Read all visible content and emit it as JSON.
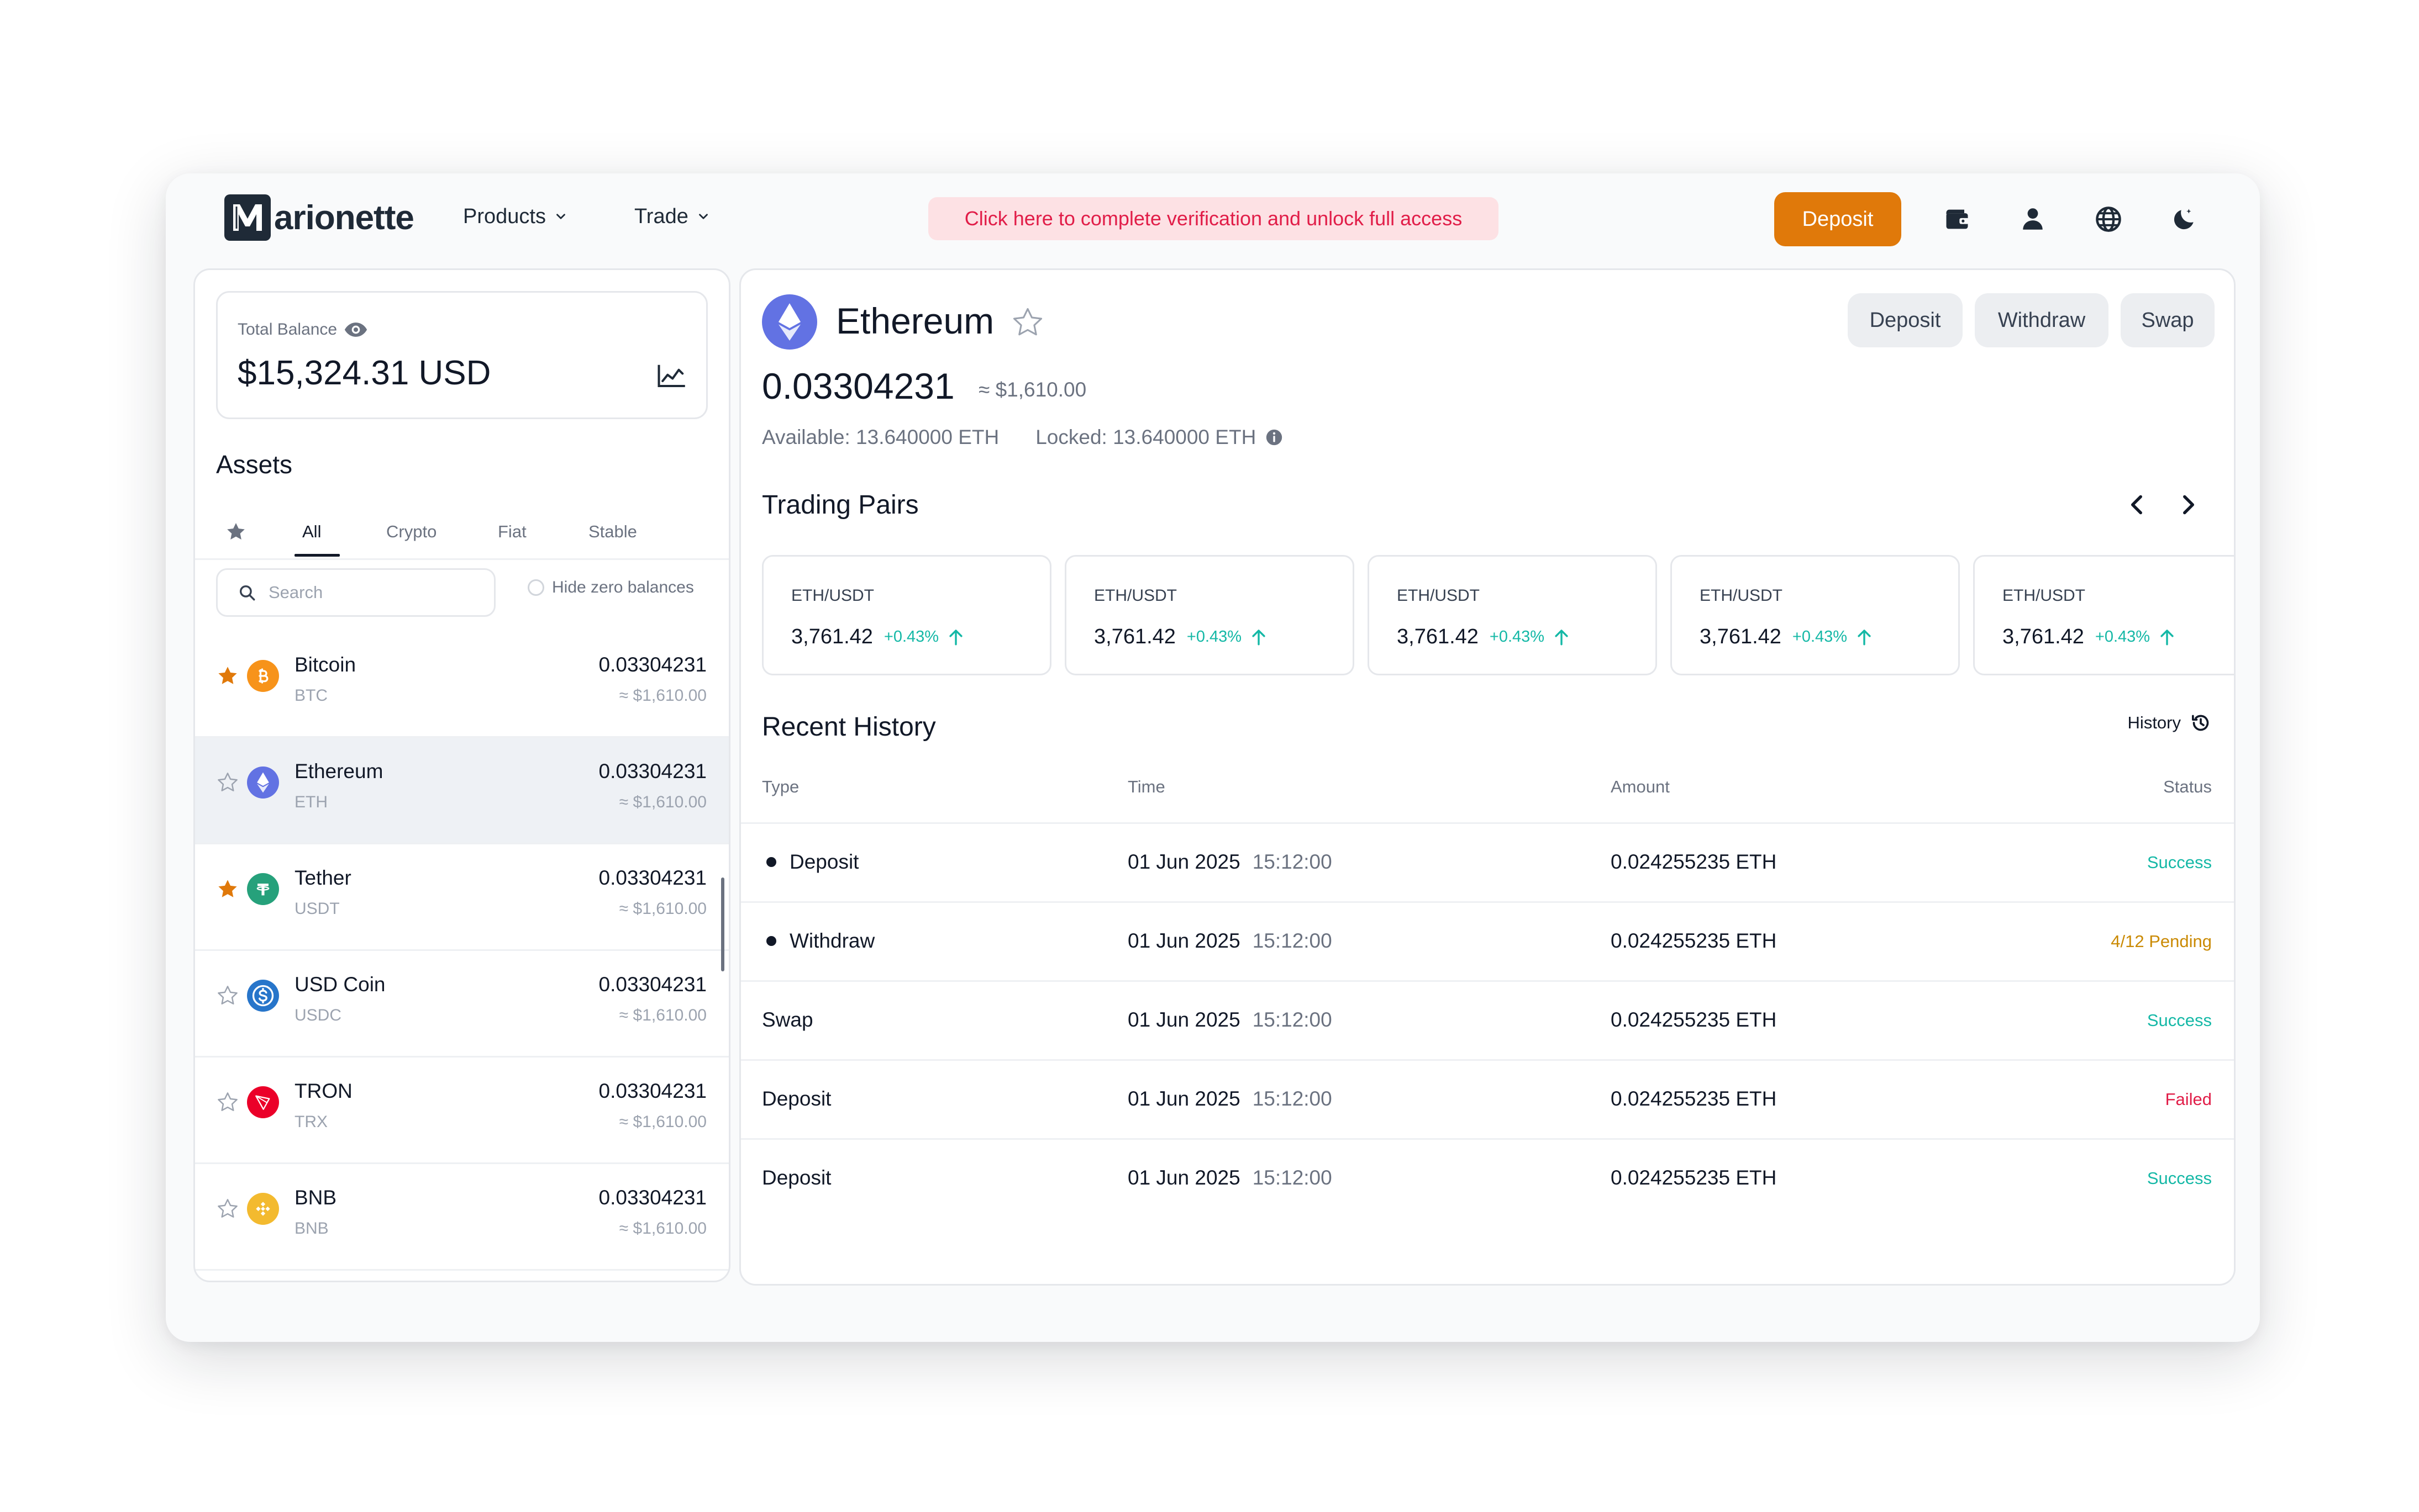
{
  "header": {
    "logo_text": "arionette",
    "nav": [
      {
        "label": "Products"
      },
      {
        "label": "Trade"
      }
    ],
    "banner": "Click here to complete verification and unlock full access",
    "deposit_label": "Deposit"
  },
  "balance": {
    "label": "Total Balance",
    "value": "$15,324.31 USD"
  },
  "assets": {
    "title": "Assets",
    "tabs": [
      "All",
      "Crypto",
      "Fiat",
      "Stable"
    ],
    "search_placeholder": "Search",
    "hide_zero_label": "Hide zero balances",
    "items": [
      {
        "name": "Bitcoin",
        "symbol": "BTC",
        "amount": "0.03304231",
        "usd": "≈ $1,610.00",
        "favorite": true,
        "color": "#f7931a"
      },
      {
        "name": "Ethereum",
        "symbol": "ETH",
        "amount": "0.03304231",
        "usd": "≈ $1,610.00",
        "favorite": false,
        "color": "#6272e3"
      },
      {
        "name": "Tether",
        "symbol": "USDT",
        "amount": "0.03304231",
        "usd": "≈ $1,610.00",
        "favorite": true,
        "color": "#26a17b"
      },
      {
        "name": "USD Coin",
        "symbol": "USDC",
        "amount": "0.03304231",
        "usd": "≈ $1,610.00",
        "favorite": false,
        "color": "#2775ca"
      },
      {
        "name": "TRON",
        "symbol": "TRX",
        "amount": "0.03304231",
        "usd": "≈ $1,610.00",
        "favorite": false,
        "color": "#eb0029"
      },
      {
        "name": "BNB",
        "symbol": "BNB",
        "amount": "0.03304231",
        "usd": "≈ $1,610.00",
        "favorite": false,
        "color": "#f3ba2f"
      }
    ]
  },
  "coin": {
    "name": "Ethereum",
    "amount": "0.03304231",
    "usd": "≈ $1,610.00",
    "available": "Available: 13.640000 ETH",
    "locked": "Locked: 13.640000 ETH",
    "actions": [
      "Deposit",
      "Withdraw",
      "Swap"
    ]
  },
  "trading_pairs": {
    "title": "Trading Pairs",
    "items": [
      {
        "pair": "ETH/USDT",
        "price": "3,761.42",
        "change": "+0.43%"
      },
      {
        "pair": "ETH/USDT",
        "price": "3,761.42",
        "change": "+0.43%"
      },
      {
        "pair": "ETH/USDT",
        "price": "3,761.42",
        "change": "+0.43%"
      },
      {
        "pair": "ETH/USDT",
        "price": "3,761.42",
        "change": "+0.43%"
      },
      {
        "pair": "ETH/USDT",
        "price": "3,761.42",
        "change": "+0.43%"
      }
    ]
  },
  "history": {
    "title": "Recent History",
    "link_label": "History",
    "columns": [
      "Type",
      "Time",
      "Amount",
      "Status"
    ],
    "rows": [
      {
        "type": "Deposit",
        "dot": true,
        "date": "01 Jun 2025",
        "time": "15:12:00",
        "amount": "0.024255235 ETH",
        "status": "Success",
        "status_color": "#14b8a6"
      },
      {
        "type": "Withdraw",
        "dot": true,
        "date": "01 Jun 2025",
        "time": "15:12:00",
        "amount": "0.024255235 ETH",
        "status": "4/12 Pending",
        "status_color": "#ca8a04"
      },
      {
        "type": "Swap",
        "dot": false,
        "date": "01 Jun 2025",
        "time": "15:12:00",
        "amount": "0.024255235 ETH",
        "status": "Success",
        "status_color": "#14b8a6"
      },
      {
        "type": "Deposit",
        "dot": false,
        "date": "01 Jun 2025",
        "time": "15:12:00",
        "amount": "0.024255235 ETH",
        "status": "Failed",
        "status_color": "#e11d48"
      },
      {
        "type": "Deposit",
        "dot": false,
        "date": "01 Jun 2025",
        "time": "15:12:00",
        "amount": "0.024255235 ETH",
        "status": "Success",
        "status_color": "#14b8a6"
      }
    ]
  },
  "colors": {
    "accent": "#e0790a",
    "positive": "#14b8a6",
    "danger": "#e11d48",
    "warning": "#ca8a04"
  }
}
